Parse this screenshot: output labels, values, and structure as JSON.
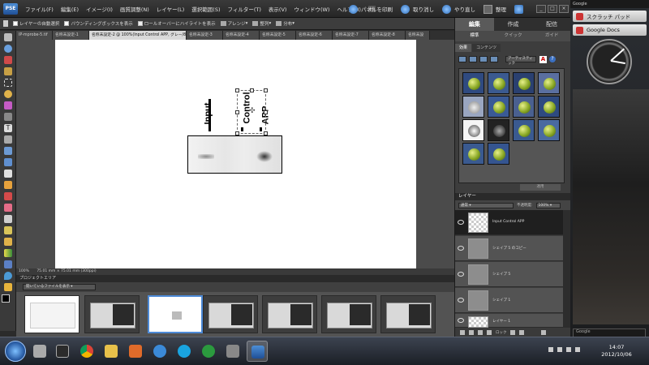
{
  "menubar": {
    "logo": "PSE",
    "items": [
      "ファイル(F)",
      "編集(E)",
      "イメージ(I)",
      "画質調整(N)",
      "レイヤー(L)",
      "選択範囲(S)",
      "フィルター(T)",
      "表示(V)",
      "ウィンドウ(W)",
      "ヘルプ(H)"
    ],
    "mode_icon": "H",
    "print_label": "パネルを印刷",
    "undo_label": "取り消し",
    "redo_label": "やり直し",
    "organize_label": "整理"
  },
  "options": {
    "auto_select": "レイヤーの自動選択",
    "bbox": "バウンディングボックスを表示",
    "highlight": "ロールオーバーにハイライトを表示",
    "arrange": "アレンジ",
    "align": "整列",
    "distribute": "分布"
  },
  "doc_tabs": [
    "IP-mprobe-5.tif",
    "名称未設定-1",
    "名称未設定-2 @ 100%(Input Control APP, グレー/8)",
    "名称未設定-3",
    "名称未設定-4",
    "名称未設定-5",
    "名称未設定-6",
    "名称未設定-7",
    "名称未設定-8",
    "名称未設"
  ],
  "canvas": {
    "labels": [
      "Input",
      "Control",
      "APP"
    ]
  },
  "status": {
    "zoom": "100%",
    "doc_info": "75.01 mm × 75.01 mm (300ppi)"
  },
  "project_bin": {
    "title": "プロジェクトエリア",
    "select": "開いているファイルを表示"
  },
  "panel": {
    "tabs": [
      "編集",
      "作成",
      "配信"
    ],
    "subtabs": [
      "標準",
      "クイック",
      "ガイド"
    ],
    "effects_tabs": [
      "効果",
      "コンテンツ"
    ],
    "effects_select": "アーティスティック",
    "apply_label": "適用",
    "layers_title": "レイヤー",
    "blend_mode": "通常",
    "opacity_label": "不透明度:",
    "opacity_value": "100%",
    "layers": [
      {
        "name": "Input Control APP"
      },
      {
        "name": "シェイプ 5 のコピー"
      },
      {
        "name": "シェイプ 5"
      },
      {
        "name": "シェイプ 1"
      },
      {
        "name": "レイヤー 1"
      }
    ],
    "lock_label": "ロック"
  },
  "gadgets": {
    "sidebar_title": "Google",
    "scratch_pad": "スクラッチ パッド",
    "google_docs": "Google Docs",
    "search_title": "Google"
  },
  "taskbar": {
    "time": "14:07",
    "date": "2012/10/06"
  }
}
